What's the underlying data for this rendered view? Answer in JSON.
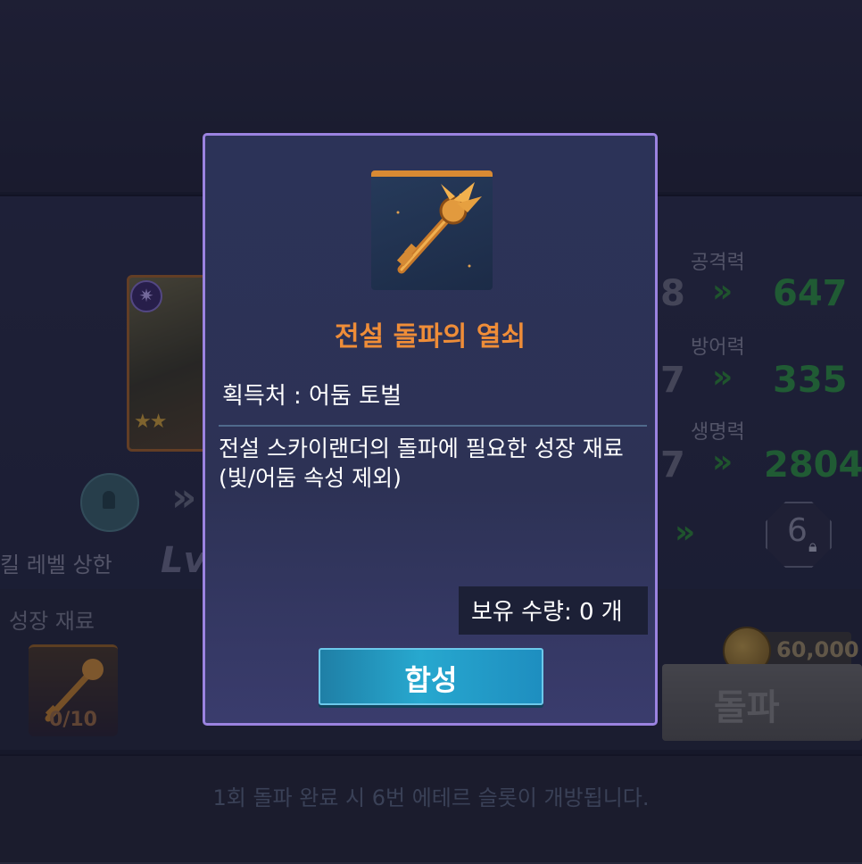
{
  "popup": {
    "item_name": "전설 돌파의 열쇠",
    "source": "획득처 : 어둠 토벌",
    "description": "전설 스카이랜더의 돌파에 필요한 성장 재료 (빛/어둠 속성 제외)",
    "owned": "보유 수량: 0 개",
    "synth_button": "합성",
    "item_icon": "golden-key-icon",
    "title_color": "#ef8d38"
  },
  "background": {
    "skill_label": "킬 레벨 상한",
    "level_label": "Lv",
    "material_label": "성장 재료",
    "material_count": "0/10",
    "stats": [
      {
        "label": "공격력",
        "old": "8",
        "new": "647"
      },
      {
        "label": "방어력",
        "old": "7",
        "new": "335"
      },
      {
        "label": "생명력",
        "old": "7",
        "new": "2804"
      }
    ],
    "slot_number": "6",
    "cost": "60,000",
    "breakthrough_button": "돌파",
    "footer_note": "1회 돌파 완료 시 6번 에테르 슬롯이 개방됩니다."
  }
}
